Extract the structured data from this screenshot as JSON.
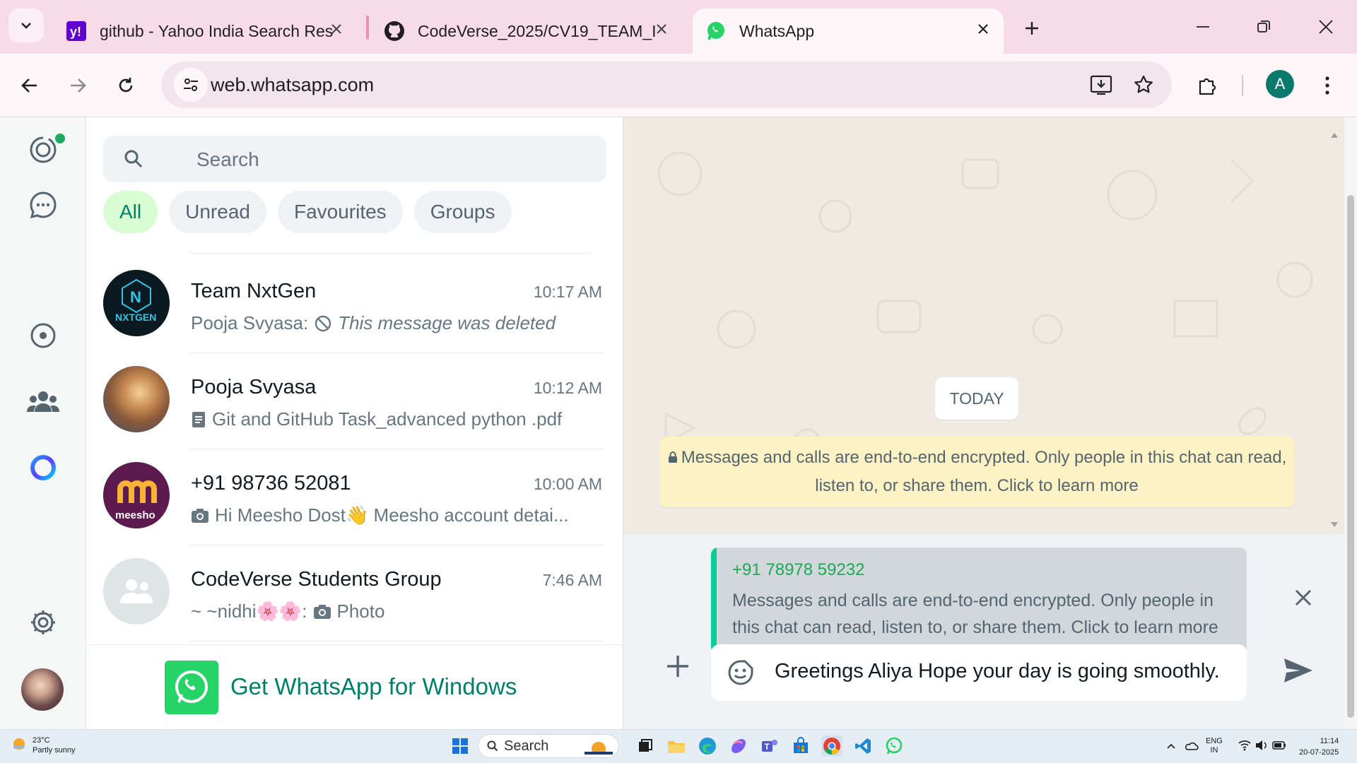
{
  "browser": {
    "tabs": [
      {
        "title": "github - Yahoo India Search Res",
        "favicon": "yahoo-icon"
      },
      {
        "title": "CodeVerse_2025/CV19_TEAM_I",
        "favicon": "github-icon"
      },
      {
        "title": "WhatsApp",
        "favicon": "whatsapp-icon",
        "active": true
      }
    ],
    "url": "web.whatsapp.com",
    "profile_initial": "A"
  },
  "whatsapp": {
    "search_placeholder": "Search",
    "filters": [
      "All",
      "Unread",
      "Favourites",
      "Groups"
    ],
    "active_filter": "All",
    "chats": [
      {
        "name": "Team NxtGen",
        "time": "10:17 AM",
        "preview_sender": "Pooja Svyasa:",
        "preview": "This message was deleted",
        "preview_icon": "blocked-icon"
      },
      {
        "name": "Pooja Svyasa",
        "time": "10:12 AM",
        "preview_sender": "",
        "preview": "Git and GitHub Task_advanced python .pdf",
        "preview_icon": "document-icon"
      },
      {
        "name": "+91 98736 52081",
        "time": "10:00 AM",
        "preview_sender": "",
        "preview": "Hi Meesho Dost👋 Meesho account detai...",
        "preview_icon": "camera-icon"
      },
      {
        "name": "CodeVerse Students Group",
        "time": "7:46 AM",
        "preview_sender": "~ ~nidhi🌸🌸:",
        "preview": "Photo",
        "preview_icon": "camera-icon"
      }
    ],
    "meesho_logo_text": "meesho",
    "nxtgen_logo_text": "NXTGEN",
    "get_app_text": "Get WhatsApp for Windows",
    "date_chip": "TODAY",
    "e2e_notice": "Messages and calls are end-to-end encrypted. Only people in this chat can read, listen to, or share them. Click to learn more",
    "reply": {
      "sender": "+91 78978 59232",
      "text": "Messages and calls are end-to-end encrypted. Only people in this chat can read, listen to, or share them. Click to learn more"
    },
    "compose_text": "Greetings Aliya Hope your day is going smoothly."
  },
  "taskbar": {
    "weather_temp": "23°C",
    "weather_desc": "Partly sunny",
    "search_label": "Search",
    "lang_line1": "ENG",
    "lang_line2": "IN",
    "time": "11:14",
    "date": "20-07-2025"
  },
  "colors": {
    "accent": "#008069",
    "whatsapp_green": "#25d366",
    "reply_bar": "#06cf9c",
    "tab_strip": "#f7dbe7"
  }
}
